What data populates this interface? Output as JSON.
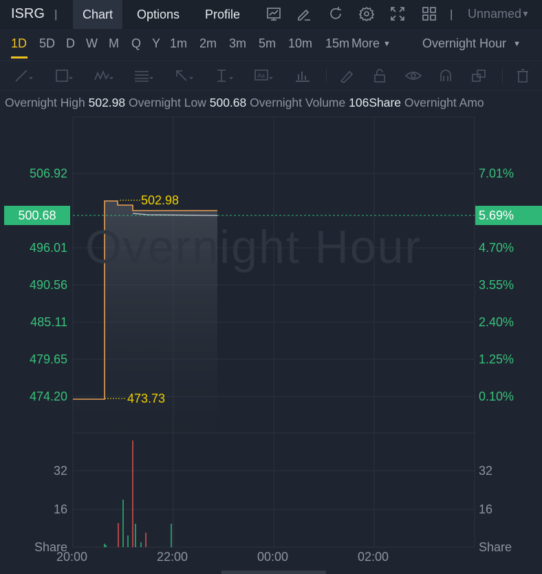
{
  "topbar": {
    "ticker": "ISRG",
    "tabs": [
      "Chart",
      "Options",
      "Profile"
    ],
    "layout_name": "Unnamed"
  },
  "intervals": {
    "items": [
      "1D",
      "5D",
      "D",
      "W",
      "M",
      "Q",
      "Y",
      "1m",
      "2m",
      "3m",
      "5m",
      "10m",
      "15m"
    ],
    "more_label": "More",
    "session_select": "Overnight Hour"
  },
  "stats": {
    "high_label": "Overnight High",
    "high_value": "502.98",
    "low_label": "Overnight Low",
    "low_value": "500.68",
    "volume_label": "Overnight Volume",
    "volume_value": "106Share",
    "amount_label": "Overnight Amo"
  },
  "chart": {
    "watermark": "Overnight Hour",
    "price_labels": [
      "506.92",
      "496.01",
      "490.56",
      "485.11",
      "479.65",
      "474.20"
    ],
    "pct_labels": [
      "7.01%",
      "4.70%",
      "3.55%",
      "2.40%",
      "1.25%",
      "0.10%"
    ],
    "current_price": "500.68",
    "current_pct": "5.69%",
    "high_annotation": "502.98",
    "low_annotation": "473.73",
    "volume_labels": [
      "32",
      "16",
      "Share"
    ],
    "x_labels": [
      "20:00",
      "22:00",
      "00:00",
      "02:00"
    ],
    "colors": {
      "up": "#2fb777",
      "down": "#e0524f",
      "line": "#e8a055",
      "annotation": "#f0d000"
    }
  }
}
